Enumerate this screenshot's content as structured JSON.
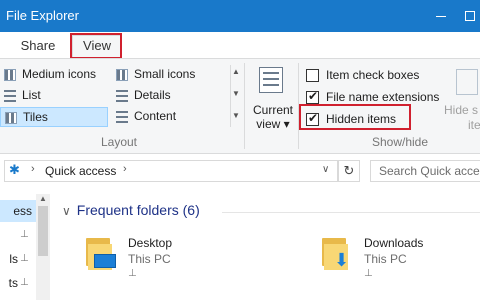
{
  "window": {
    "title": "File Explorer"
  },
  "tabs": [
    {
      "label": "Share"
    },
    {
      "label": "View",
      "selected": true
    }
  ],
  "ribbon": {
    "layout": {
      "items": [
        {
          "label": "Medium icons",
          "icon": "medium-icons-icon"
        },
        {
          "label": "Small icons",
          "icon": "small-icons-icon"
        },
        {
          "label": "List",
          "icon": "list-icon"
        },
        {
          "label": "Details",
          "icon": "details-icon"
        },
        {
          "label": "Tiles",
          "icon": "tiles-icon",
          "selected": true
        },
        {
          "label": "Content",
          "icon": "content-icon"
        }
      ],
      "group_label": "Layout"
    },
    "current_view": {
      "label_line1": "Current",
      "label_line2": "view",
      "dropdown": "▾"
    },
    "show_hide": {
      "item_check_boxes": {
        "label": "Item check boxes",
        "checked": false
      },
      "file_name_extensions": {
        "label": "File name extensions",
        "checked": true
      },
      "hidden_items": {
        "label": "Hidden items",
        "checked": true
      },
      "group_label": "Show/hide",
      "hide_selected_line1": "Hide s",
      "hide_selected_line2": "ite"
    },
    "check_glyph": "✔"
  },
  "address_bar": {
    "path": "Quick access",
    "separator": "›",
    "dropdown": "∨",
    "refresh": "↻",
    "search_placeholder": "Search Quick access"
  },
  "nav_pane": {
    "items": [
      {
        "label": "ess",
        "selected": true
      },
      {
        "label": "",
        "pinned": true
      },
      {
        "label": "ls",
        "pinned": true
      },
      {
        "label": "ts",
        "pinned": true
      }
    ],
    "pin_glyph": "📌"
  },
  "content": {
    "section_title": "Frequent folders (6)",
    "chevron": "∨",
    "folders": [
      {
        "name": "Desktop",
        "location": "This PC",
        "type": "desktop"
      },
      {
        "name": "Downloads",
        "location": "This PC",
        "type": "downloads"
      }
    ]
  },
  "colors": {
    "titlebar": "#1979ca",
    "highlight_box": "#d0202e",
    "selected_bg": "#cce8ff",
    "section_title": "#1e3287"
  }
}
